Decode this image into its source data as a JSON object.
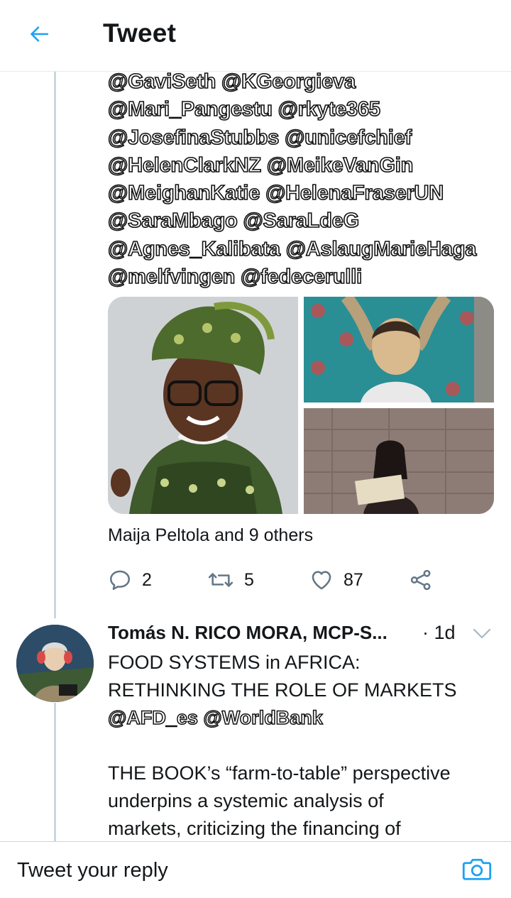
{
  "header": {
    "title": "Tweet"
  },
  "tweet": {
    "mention_lines": [
      "@GaviSeth @KGeorgieva",
      "@Mari_Pangestu @rkyte365",
      "@JosefinaStubbs @unicefchief",
      "@HelenClarkNZ @MeikeVanGin",
      "@MeighanKatie @HelenaFraserUN",
      "@SaraMbago @SaraLdeG",
      "@Agnes_Kalibata @AslaugMarieHaga",
      "@melfvingen @fedecerulli"
    ],
    "liked_by": "Maija Peltola and 9 others",
    "replies": "2",
    "retweets": "5",
    "likes": "87"
  },
  "reply_tweet": {
    "author": "Tomás N. RICO MORA, MCP-S...",
    "time": "· 1d",
    "lines": [
      "FOOD SYSTEMS in AFRICA:",
      "RETHINKING THE ROLE OF MARKETS",
      "@AFD_es @WorldBank",
      "THE BOOK’s “farm-to-table” perspective",
      "underpins a systemic analysis of",
      "markets, criticizing the financing of"
    ]
  },
  "composer": {
    "placeholder": "Tweet your reply"
  },
  "colors": {
    "accent": "#1da1f2",
    "thread_line": "#ccd6dd",
    "divider": "#e6ecf0"
  }
}
